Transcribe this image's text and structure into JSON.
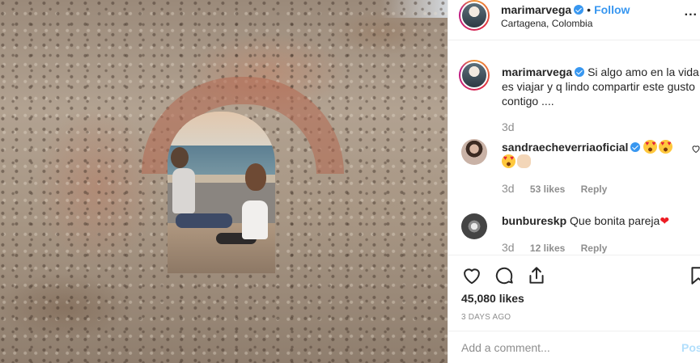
{
  "post": {
    "author": "marimarvega",
    "follow_label": "Follow",
    "separator": "•",
    "location": "Cartagena, Colombia",
    "more_label": "...",
    "caption_author": "marimarvega",
    "caption_text": "Si algo amo en la vida es viajar y q lindo compartir este gusto contigo ....",
    "caption_time": "3d"
  },
  "comments": [
    {
      "user": "sandraecheverriaoficial",
      "emojis": [
        "smiling-face-heart-eyes",
        "smiling-face-heart-eyes",
        "smiling-face-heart-eyes",
        "clapping-hands"
      ],
      "time": "3d",
      "likes": "53 likes",
      "reply": "Reply"
    },
    {
      "user": "bunbureskp",
      "text": "Que bonita pareja",
      "emoji": "red-heart",
      "time": "3d",
      "likes": "12 likes",
      "reply": "Reply"
    }
  ],
  "footer": {
    "likes": "45,080 likes",
    "ago": "3 DAYS AGO",
    "comment_placeholder": "Add a comment...",
    "post_label": "Post"
  },
  "colors": {
    "link_blue": "#3897f0",
    "muted": "#8e8e8e",
    "post_disabled": "#b2dffc"
  },
  "icons": [
    "heart-icon",
    "comment-icon",
    "share-icon",
    "bookmark-icon",
    "verified-badge-icon",
    "comment-heart-icon"
  ]
}
